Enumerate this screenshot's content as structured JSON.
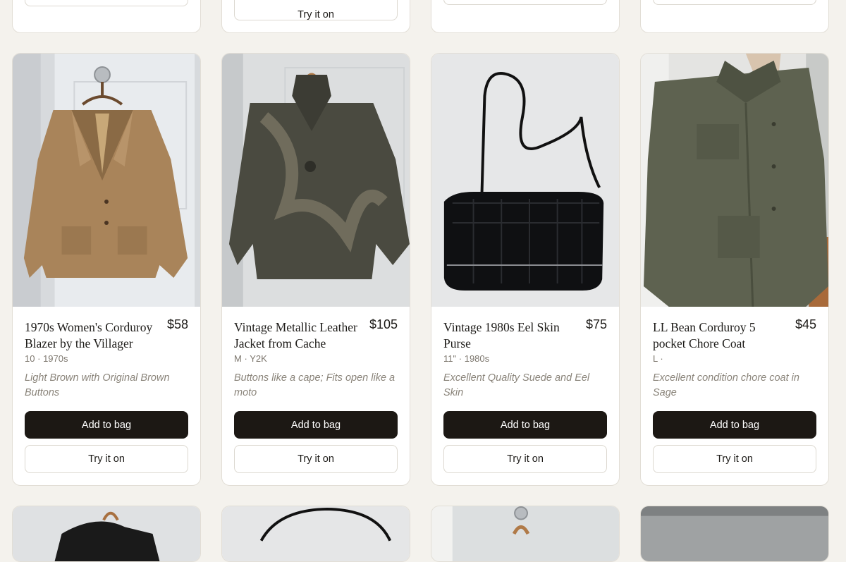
{
  "top_row": [
    {
      "try_label": ""
    },
    {
      "try_label": "Try it on"
    },
    {
      "try_label": ""
    },
    {
      "try_label": ""
    }
  ],
  "products": [
    {
      "title": "1970s Women's Corduroy Blazer by the Villager",
      "price": "$58",
      "size": "10",
      "era": "1970s",
      "separator": "·",
      "description": "Light Brown with Original Brown Buttons",
      "add_label": "Add to bag",
      "try_label": "Try it on"
    },
    {
      "title": "Vintage Metallic Leather Jacket from Cache",
      "price": "$105",
      "size": "M",
      "era": "Y2K",
      "separator": "·",
      "description": "Buttons like a cape; Fits open like a moto",
      "add_label": "Add to bag",
      "try_label": "Try it on"
    },
    {
      "title": "Vintage 1980s Eel Skin Purse",
      "price": "$75",
      "size": "11\"",
      "era": "1980s",
      "separator": "·",
      "description": "Excellent Quality Suede and Eel Skin",
      "add_label": "Add to bag",
      "try_label": "Try it on"
    },
    {
      "title": "LL Bean Corduroy 5 pocket Chore Coat",
      "price": "$45",
      "size": "L",
      "era": "",
      "separator": "·",
      "description": "Excellent condition chore coat in Sage",
      "add_label": "Add to bag",
      "try_label": "Try it on"
    }
  ],
  "colors": {
    "page_bg": "#f4f2ed",
    "button_dark": "#1c1814",
    "card_border": "#e2ded6"
  }
}
